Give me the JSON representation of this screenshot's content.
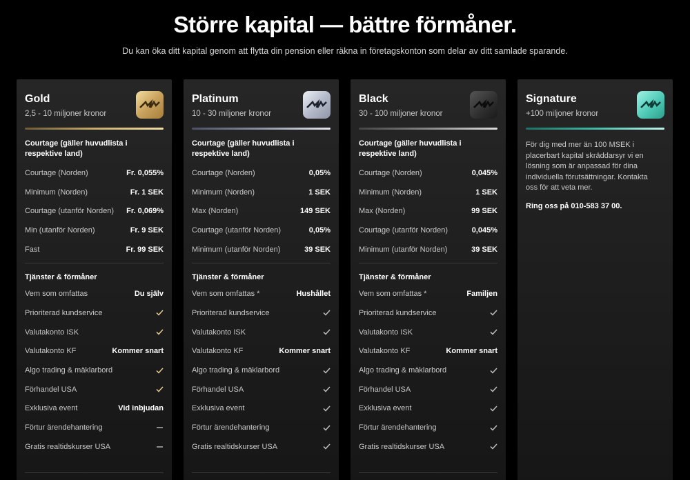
{
  "header": {
    "title": "Större kapital — bättre förmåner.",
    "subtitle": "Du kan öka ditt kapital genom att flytta din pension eller räkna in företagskonton som delar av ditt samlade sparande."
  },
  "colors": {
    "gold_check": "#e9cf8f",
    "default_check": "#bfbfbf"
  },
  "cards": [
    {
      "name": "Gold",
      "range": "2,5 - 10 miljoner kronor",
      "courtage_title": "Courtage (gäller huvudlista i respektive land)",
      "courtage": [
        {
          "label": "Courtage (Norden)",
          "value": "Fr. 0,055%"
        },
        {
          "label": "Minimum (Norden)",
          "value": "Fr. 1 SEK"
        },
        {
          "label": "Courtage (utanför Norden)",
          "value": "Fr. 0,069%"
        },
        {
          "label": "Min (utanför Norden)",
          "value": "Fr. 9 SEK"
        },
        {
          "label": "Fast",
          "value": "Fr. 99 SEK"
        }
      ],
      "services_title": "Tjänster & förmåner",
      "services": [
        {
          "label": "Vem som omfattas",
          "value": "Du själv"
        },
        {
          "label": "Prioriterad kundservice",
          "icon": "check-icon"
        },
        {
          "label": "Valutakonto ISK",
          "icon": "check-icon"
        },
        {
          "label": "Valutakonto KF",
          "value": "Kommer snart"
        },
        {
          "label": "Algo trading & mäklarbord",
          "icon": "check-icon"
        },
        {
          "label": "Förhandel USA",
          "icon": "check-icon"
        },
        {
          "label": "Exklusiva event",
          "value": "Vid inbjudan"
        },
        {
          "label": "Förtur ärendehantering",
          "icon": "dash-icon"
        },
        {
          "label": "Gratis realtidskurser USA",
          "icon": "dash-icon"
        }
      ]
    },
    {
      "name": "Platinum",
      "range": "10 - 30 miljoner kronor",
      "courtage_title": "Courtage (gäller huvudlista i respektive land)",
      "courtage": [
        {
          "label": "Courtage (Norden)",
          "value": "0,05%"
        },
        {
          "label": "Minimum (Norden)",
          "value": "1 SEK"
        },
        {
          "label": "Max (Norden)",
          "value": "149 SEK"
        },
        {
          "label": "Courtage (utanför Norden)",
          "value": "0,05%"
        },
        {
          "label": "Minimum (utanför Norden)",
          "value": "39 SEK"
        }
      ],
      "services_title": "Tjänster & förmåner",
      "services": [
        {
          "label": "Vem som omfattas *",
          "value": "Hushållet"
        },
        {
          "label": "Prioriterad kundservice",
          "icon": "check-icon"
        },
        {
          "label": "Valutakonto ISK",
          "icon": "check-icon"
        },
        {
          "label": "Valutakonto KF",
          "value": "Kommer snart"
        },
        {
          "label": "Algo trading & mäklarbord",
          "icon": "check-icon"
        },
        {
          "label": "Förhandel USA",
          "icon": "check-icon"
        },
        {
          "label": "Exklusiva event",
          "icon": "check-icon"
        },
        {
          "label": "Förtur ärendehantering",
          "icon": "check-icon"
        },
        {
          "label": "Gratis realtidskurser USA",
          "icon": "check-icon"
        }
      ]
    },
    {
      "name": "Black",
      "range": "30 - 100 miljoner kronor",
      "courtage_title": "Courtage (gäller huvudlista i respektive land)",
      "courtage": [
        {
          "label": "Courtage (Norden)",
          "value": "0,045%"
        },
        {
          "label": "Minimum (Norden)",
          "value": "1 SEK"
        },
        {
          "label": "Max (Norden)",
          "value": "99 SEK"
        },
        {
          "label": "Courtage (utanför Norden)",
          "value": "0,045%"
        },
        {
          "label": "Minimum (utanför Norden)",
          "value": "39 SEK"
        }
      ],
      "services_title": "Tjänster & förmåner",
      "services": [
        {
          "label": "Vem som omfattas *",
          "value": "Familjen"
        },
        {
          "label": "Prioriterad kundservice",
          "icon": "check-icon"
        },
        {
          "label": "Valutakonto ISK",
          "icon": "check-icon"
        },
        {
          "label": "Valutakonto KF",
          "value": "Kommer snart"
        },
        {
          "label": "Algo trading & mäklarbord",
          "icon": "check-icon"
        },
        {
          "label": "Förhandel USA",
          "icon": "check-icon"
        },
        {
          "label": "Exklusiva event",
          "icon": "check-icon"
        },
        {
          "label": "Förtur ärendehantering",
          "icon": "check-icon"
        },
        {
          "label": "Gratis realtidskurser USA",
          "icon": "check-icon"
        }
      ]
    }
  ],
  "signature": {
    "name": "Signature",
    "range": "+100 miljoner kronor",
    "description": "För dig med mer än 100 MSEK i placerbart kapital skräddarsyr vi en lösning som är anpassad för dina individuella förutsättningar. Kontakta oss för att veta mer.",
    "phone": "Ring oss på 010-583 37 00."
  }
}
